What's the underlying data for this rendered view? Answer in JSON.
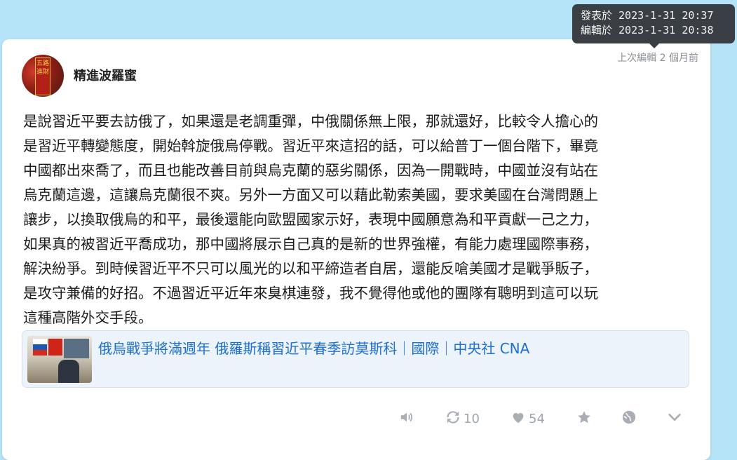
{
  "tooltip": {
    "published": "發表於 2023-1-31 20:37",
    "edited": "編輯於 2023-1-31 20:38"
  },
  "post": {
    "username": "精進波羅蜜",
    "edited_label": "上次編輯 2 個月前",
    "avatar_text": "五路進財",
    "lines": [
      "是說習近平要去訪俄了，如果還是老調重彈，中俄關係無上限，那就還好，比較令人擔心的",
      "是習近平轉變態度，開始斡旋俄烏停戰。習近平來這招的話，可以給普丁一個台階下，畢竟",
      "中國都出來喬了，而且也能改善目前與烏克蘭的惡劣關係，因為一開戰時，中國並沒有站在",
      "烏克蘭這邊，這讓烏克蘭很不爽。另外一方面又可以藉此勒索美國，要求美國在台灣問題上",
      "讓步，以換取俄烏的和平，最後還能向歐盟國家示好，表現中國願意為和平貢獻一己之力，",
      "如果真的被習近平喬成功，那中國將展示自己真的是新的世界強權，有能力處理國際事務，",
      "解決紛爭。到時候習近平不只可以風光的以和平締造者自居，還能反嗆美國才是戰爭販子，",
      "是攻守兼備的好招。不過習近平近年來臭棋連發，我不覺得他或他的團隊有聰明到這可以玩",
      "這種高階外交手段。"
    ],
    "link": {
      "title": "俄烏戰爭將滿週年 俄羅斯稱習近平春季訪莫斯科｜國際｜中央社 CNA"
    },
    "actions": {
      "boost_count": "10",
      "like_count": "54"
    }
  },
  "icons": {
    "speaker": "speaker-icon",
    "repost": "repost-icon",
    "heart": "heart-icon",
    "star": "star-icon",
    "globe": "globe-icon",
    "chevron": "chevron-down-icon"
  },
  "colors": {
    "background": "#b5e4f8",
    "link": "#1d6fd1",
    "tooltip_bg": "#3a3f45",
    "icon": "#a9aeb5"
  }
}
